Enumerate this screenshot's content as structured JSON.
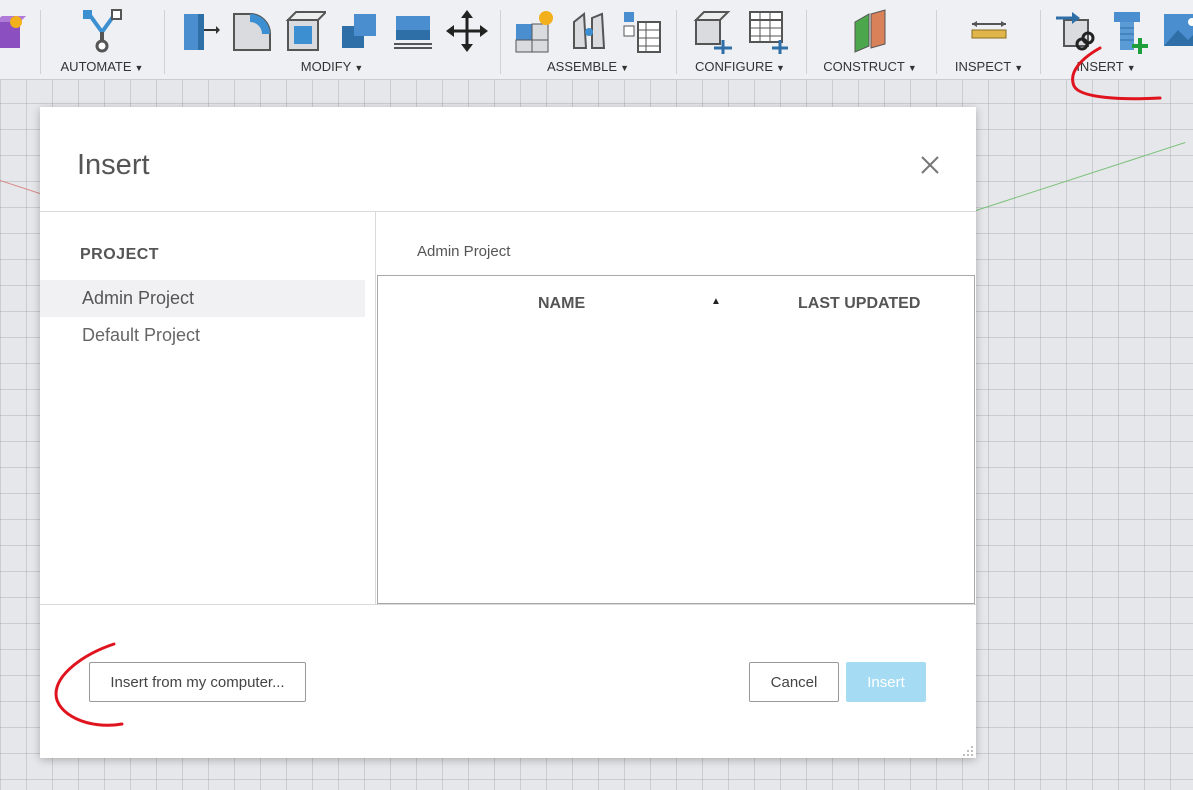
{
  "toolbar": {
    "groups": [
      {
        "label": "AUTOMATE",
        "icons": [
          "automate-node-icon"
        ]
      },
      {
        "label": "MODIFY",
        "icons": [
          "press-pull-icon",
          "fillet-icon",
          "shell-icon",
          "combine-icon",
          "offset-face-icon",
          "move-icon"
        ]
      },
      {
        "label": "ASSEMBLE",
        "icons": [
          "new-component-icon",
          "joint-icon",
          "table-icon"
        ]
      },
      {
        "label": "CONFIGURE",
        "icons": [
          "configure-cube-icon",
          "configure-table-icon"
        ]
      },
      {
        "label": "CONSTRUCT",
        "icons": [
          "construct-plane-icon"
        ]
      },
      {
        "label": "INSPECT",
        "icons": [
          "measure-icon"
        ]
      },
      {
        "label": "INSERT",
        "icons": [
          "insert-derive-icon",
          "insert-mcmaster-icon",
          "insert-canvas-icon"
        ]
      }
    ],
    "left_icon": "create-sketch-icon"
  },
  "dialog": {
    "title": "Insert",
    "close_icon": "close-icon",
    "sidebar": {
      "heading": "PROJECT",
      "items": [
        {
          "label": "Admin Project",
          "active": true
        },
        {
          "label": "Default Project",
          "active": false
        }
      ]
    },
    "breadcrumb": "Admin Project",
    "table": {
      "columns": [
        "NAME",
        "LAST UPDATED"
      ],
      "sort_indicator": "▲",
      "rows": []
    },
    "buttons": {
      "insert_from_computer": "Insert from my computer...",
      "cancel": "Cancel",
      "insert": "Insert"
    }
  },
  "colors": {
    "accent_blue": "#3c8fd0",
    "primary_button": "#a5dcf3",
    "annotation": "#e0141e"
  }
}
